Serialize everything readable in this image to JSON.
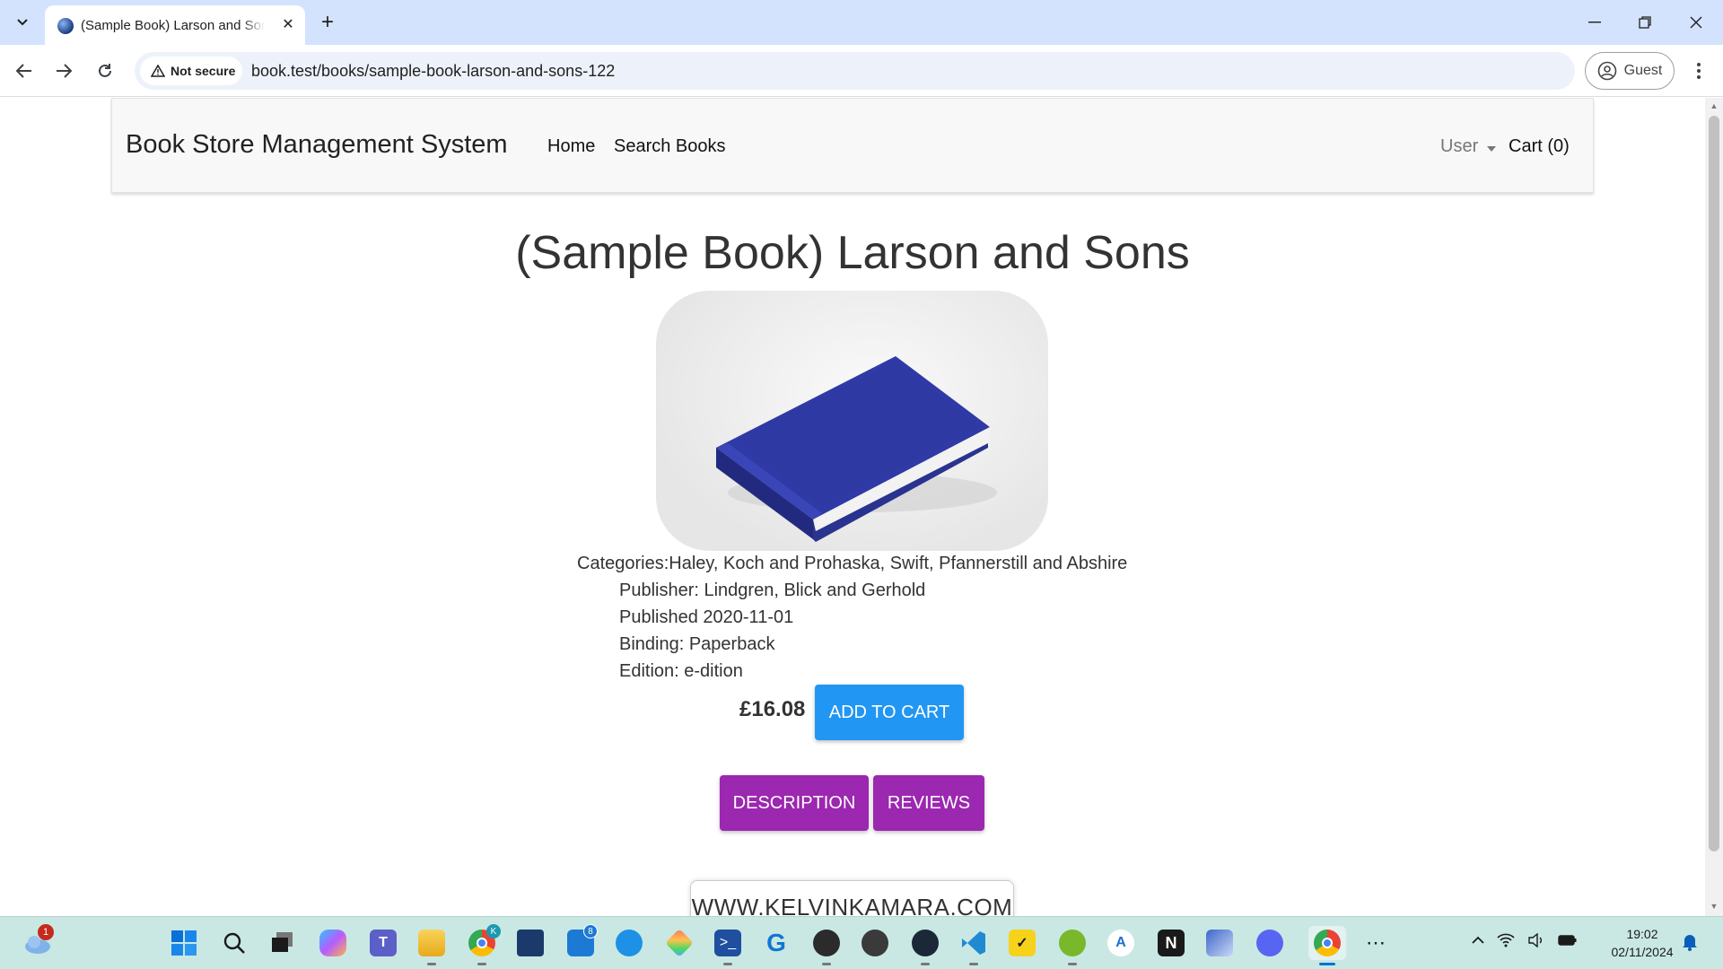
{
  "browser": {
    "tab_title": "(Sample Book) Larson and Sons",
    "security_label": "Not secure",
    "url": "book.test/books/sample-book-larson-and-sons-122",
    "profile_label": "Guest"
  },
  "navbar": {
    "brand": "Book Store Management System",
    "links": [
      "Home",
      "Search Books"
    ],
    "user_label": "User",
    "cart_label": "Cart (0)"
  },
  "book": {
    "title": "(Sample Book) Larson and Sons",
    "categories": "Categories:Haley, Koch and Prohaska, Swift, Pfannerstill and Abshire",
    "publisher": "Publisher: Lindgren, Blick and Gerhold",
    "published": "Published 2020-11-01",
    "binding": "Binding: Paperback",
    "edition": "Edition: e-dition",
    "price": "£16.08",
    "add_to_cart_label": "ADD TO CART",
    "description_label": "DESCRIPTION",
    "reviews_label": "REVIEWS"
  },
  "watermark": "WWW.KELVINKAMARA.COM",
  "taskbar": {
    "weather_badge": "1",
    "chrome_badge": "K",
    "mail_badge": "8",
    "time": "19:02",
    "date": "02/11/2024"
  },
  "colors": {
    "add_to_cart": "#2196f3",
    "tab_buttons": "#9c27b0",
    "tab_strip": "#d3e3fd",
    "taskbar": "#c9e8e4"
  }
}
